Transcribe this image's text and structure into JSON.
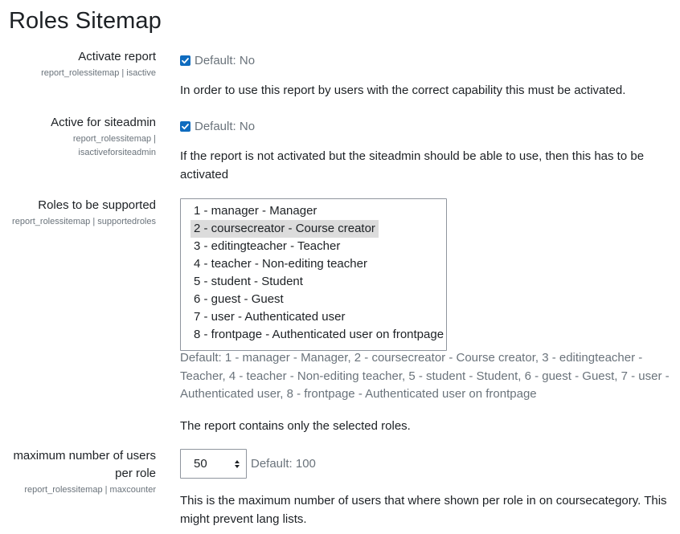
{
  "page": {
    "title": "Roles Sitemap"
  },
  "settings": {
    "activate": {
      "title": "Activate report",
      "key": "report_rolessitemap | isactive",
      "default": "Default: No",
      "description": "In order to use this report by users with the correct capability this must be activated."
    },
    "siteadmin": {
      "title": "Active for siteadmin",
      "key_line1": "report_rolessitemap |",
      "key_line2": "isactiveforsiteadmin",
      "default": "Default: No",
      "description": "If the report is not activated but the siteadmin should be able to use, then this has to be activated"
    },
    "roles": {
      "title": "Roles to be supported",
      "key": "report_rolessitemap | supportedroles",
      "options": [
        "1 - manager - Manager",
        "2 - coursecreator - Course creator",
        "3 - editingteacher - Teacher",
        "4 - teacher - Non-editing teacher",
        "5 - student - Student",
        "6 - guest - Guest",
        "7 - user - Authenticated user",
        "8 - frontpage - Authenticated user on frontpage"
      ],
      "default": "Default: 1 - manager - Manager, 2 - coursecreator - Course creator, 3 - editingteacher - Teacher, 4 - teacher - Non-editing teacher, 5 - student - Student, 6 - guest - Guest, 7 - user - Authenticated user, 8 - frontpage - Authenticated user on frontpage",
      "description": "The report contains only the selected roles."
    },
    "maxcounter": {
      "title_line1": "maximum number of users",
      "title_line2": "per role",
      "key": "report_rolessitemap | maxcounter",
      "value": "50",
      "default": "Default: 100",
      "description": "This is the maximum number of users that where shown per role in on coursecategory. This might prevent lang lists."
    }
  },
  "colors": {
    "accent": "#0f6cbf",
    "muted": "#6a737b",
    "selected_bg": "#dcdcdc"
  }
}
